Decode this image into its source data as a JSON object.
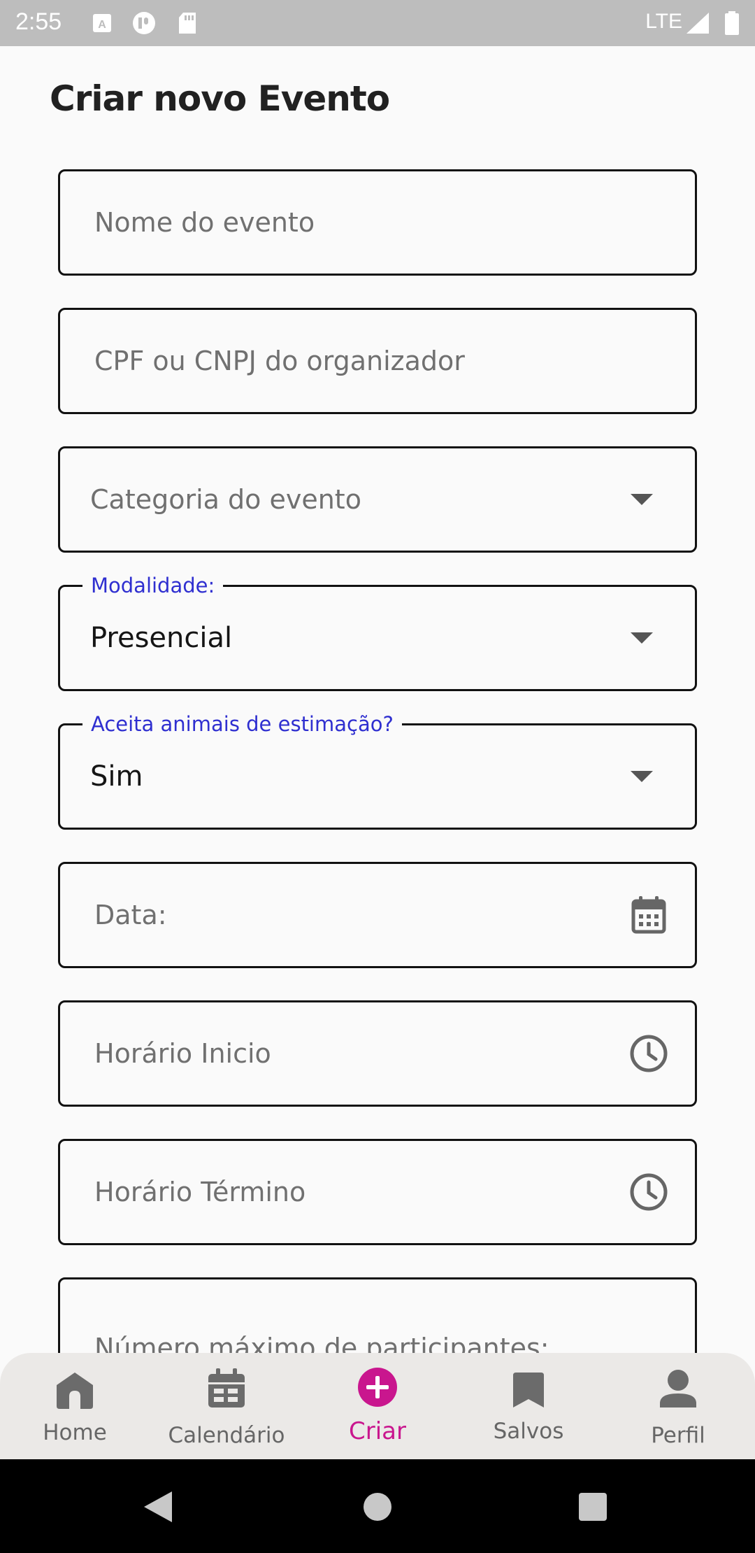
{
  "status_bar": {
    "time": "2:55",
    "network": "LTE"
  },
  "page": {
    "title": "Criar novo Evento"
  },
  "form": {
    "event_name": {
      "placeholder": "Nome do evento"
    },
    "organizer_doc": {
      "placeholder": "CPF ou CNPJ do organizador"
    },
    "category": {
      "placeholder": "Categoria do evento"
    },
    "modality": {
      "label": "Modalidade:",
      "value": "Presencial"
    },
    "pets": {
      "label": "Aceita animais de estimação?",
      "value": "Sim"
    },
    "date": {
      "placeholder": "Data:"
    },
    "start_time": {
      "placeholder": "Horário Inicio"
    },
    "end_time": {
      "placeholder": "Horário Término"
    },
    "max_participants": {
      "placeholder": "Número máximo de participantes:"
    }
  },
  "bottom_nav": {
    "items": [
      {
        "label": "Home",
        "icon": "home-icon"
      },
      {
        "label": "Calendário",
        "icon": "calendar-icon"
      },
      {
        "label": "Criar",
        "icon": "add-circle-icon",
        "active": true
      },
      {
        "label": "Salvos",
        "icon": "bookmark-icon"
      },
      {
        "label": "Perfil",
        "icon": "person-icon"
      }
    ]
  },
  "colors": {
    "accent": "#c9168e",
    "label_blue": "#2f2fd0",
    "status_bar": "#bdbdbd",
    "nav_background": "#ebe9e7"
  }
}
